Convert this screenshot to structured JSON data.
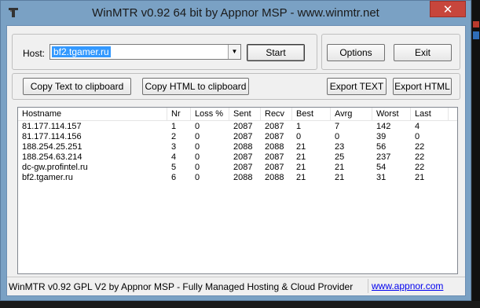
{
  "window": {
    "title": "WinMTR v0.92 64 bit by Appnor MSP - www.winmtr.net",
    "close_glyph": "✕"
  },
  "host": {
    "label": "Host:",
    "value": "bf2.tgamer.ru"
  },
  "buttons": {
    "start": "Start",
    "options": "Options",
    "exit": "Exit",
    "copy_text": "Copy Text to clipboard",
    "copy_html": "Copy HTML to clipboard",
    "export_text": "Export TEXT",
    "export_html": "Export HTML"
  },
  "table": {
    "columns": [
      "Hostname",
      "Nr",
      "Loss %",
      "Sent",
      "Recv",
      "Best",
      "Avrg",
      "Worst",
      "Last"
    ],
    "rows": [
      [
        "81.177.114.157",
        "1",
        "0",
        "2087",
        "2087",
        "1",
        "7",
        "142",
        "4"
      ],
      [
        "81.177.114.156",
        "2",
        "0",
        "2087",
        "2087",
        "0",
        "0",
        "39",
        "0"
      ],
      [
        "188.254.25.251",
        "3",
        "0",
        "2088",
        "2088",
        "21",
        "23",
        "56",
        "22"
      ],
      [
        "188.254.63.214",
        "4",
        "0",
        "2087",
        "2087",
        "21",
        "25",
        "237",
        "22"
      ],
      [
        "dc-gw.profintel.ru",
        "5",
        "0",
        "2087",
        "2087",
        "21",
        "21",
        "54",
        "22"
      ],
      [
        "bf2.tgamer.ru",
        "6",
        "0",
        "2088",
        "2088",
        "21",
        "21",
        "31",
        "21"
      ]
    ]
  },
  "status": {
    "text": "WinMTR v0.92 GPL V2 by Appnor MSP - Fully Managed Hosting & Cloud Provider",
    "link": "www.appnor.com"
  },
  "icons": {
    "app": "winmtr-app-icon",
    "dropdown": "chevron-down-icon"
  }
}
